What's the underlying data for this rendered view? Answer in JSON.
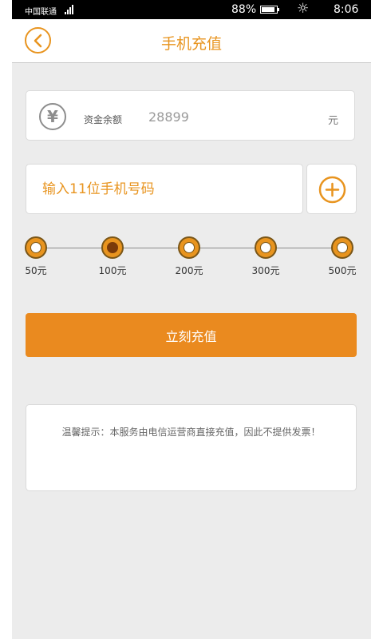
{
  "status_bar": {
    "carrier": "中国联通",
    "battery_percent": "88%",
    "time": "8:06"
  },
  "nav": {
    "title": "手机充值"
  },
  "balance": {
    "label": "资金余额",
    "value": "28899",
    "unit": "元"
  },
  "phone": {
    "placeholder": "输入11位手机号码",
    "value": ""
  },
  "amounts": {
    "options": [
      "50元",
      "100元",
      "200元",
      "300元",
      "500元"
    ],
    "selected": "100元"
  },
  "submit_label": "立刻充值",
  "tip": "温馨提示：本服务由电信运营商直接充值，因此不提供发票！",
  "colors": {
    "accent": "#e8941f",
    "button": "#ea8a1f",
    "background": "#ececec"
  },
  "icons": {
    "back": "chevron-left-icon",
    "balance": "yen-icon",
    "add_contact": "plus-circle-icon",
    "brightness": "sun-icon"
  }
}
